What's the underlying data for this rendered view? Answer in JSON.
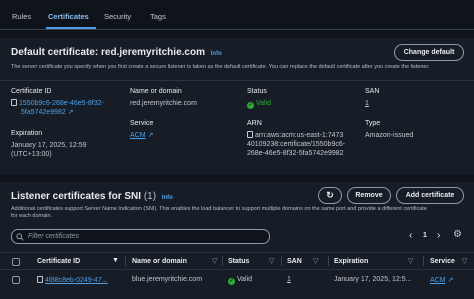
{
  "tabs": [
    "Rules",
    "Certificates",
    "Security",
    "Tags"
  ],
  "default_certificate": {
    "heading": "Default certificate:",
    "domain": "red.jeremyritchie.com",
    "info": "Info",
    "change_button": "Change default",
    "description": "The server certificate you specify when you first create a secure listener is taken as the default certificate. You can replace the default certificate after you create the listener.",
    "fields": {
      "cert_id_label": "Certificate ID",
      "cert_id_line1": "1550b9c6-268e-46e5-8f32-",
      "cert_id_line2": "5fa5742e9982",
      "name_label": "Name or domain",
      "name_value": "red.jeremyritchie.com",
      "status_label": "Status",
      "status_value": "Valid",
      "san_label": "SAN",
      "san_value": "1",
      "expiration_label": "Expiration",
      "expiration_line1": "January 17, 2025, 12:59",
      "expiration_line2": "(UTC+13:00)",
      "service_label": "Service",
      "service_value": "ACM",
      "arn_label": "ARN",
      "arn_line1": "arn:aws:acm:us-east-1:7473",
      "arn_line2": "40109238:certificate/1550b9c6-",
      "arn_line3": "268e-46e5-8f32-5fa5742e9982",
      "type_label": "Type",
      "type_value": "Amazon-issued"
    }
  },
  "sni": {
    "heading": "Listener certificates for SNI",
    "count": "(1)",
    "info": "Info",
    "remove_button": "Remove",
    "add_button": "Add certificate",
    "description_line1": "Additional certificates support Server Name Indication (SNI). This enables the load balancer to support multiple domains on the same port and provide a different certificate",
    "description_line2": "for each domain.",
    "search_placeholder": "Filter certificates",
    "page_number": "1",
    "columns": [
      "Certificate ID",
      "Name or domain",
      "Status",
      "SAN",
      "Expiration",
      "Service"
    ],
    "row": {
      "cert_id": "4f88c8eb-0249-47...",
      "name": "blue.jeremyritchie.com",
      "status": "Valid",
      "san": "1",
      "expiration": "January 17, 2025, 12:5...",
      "service": "ACM"
    }
  }
}
